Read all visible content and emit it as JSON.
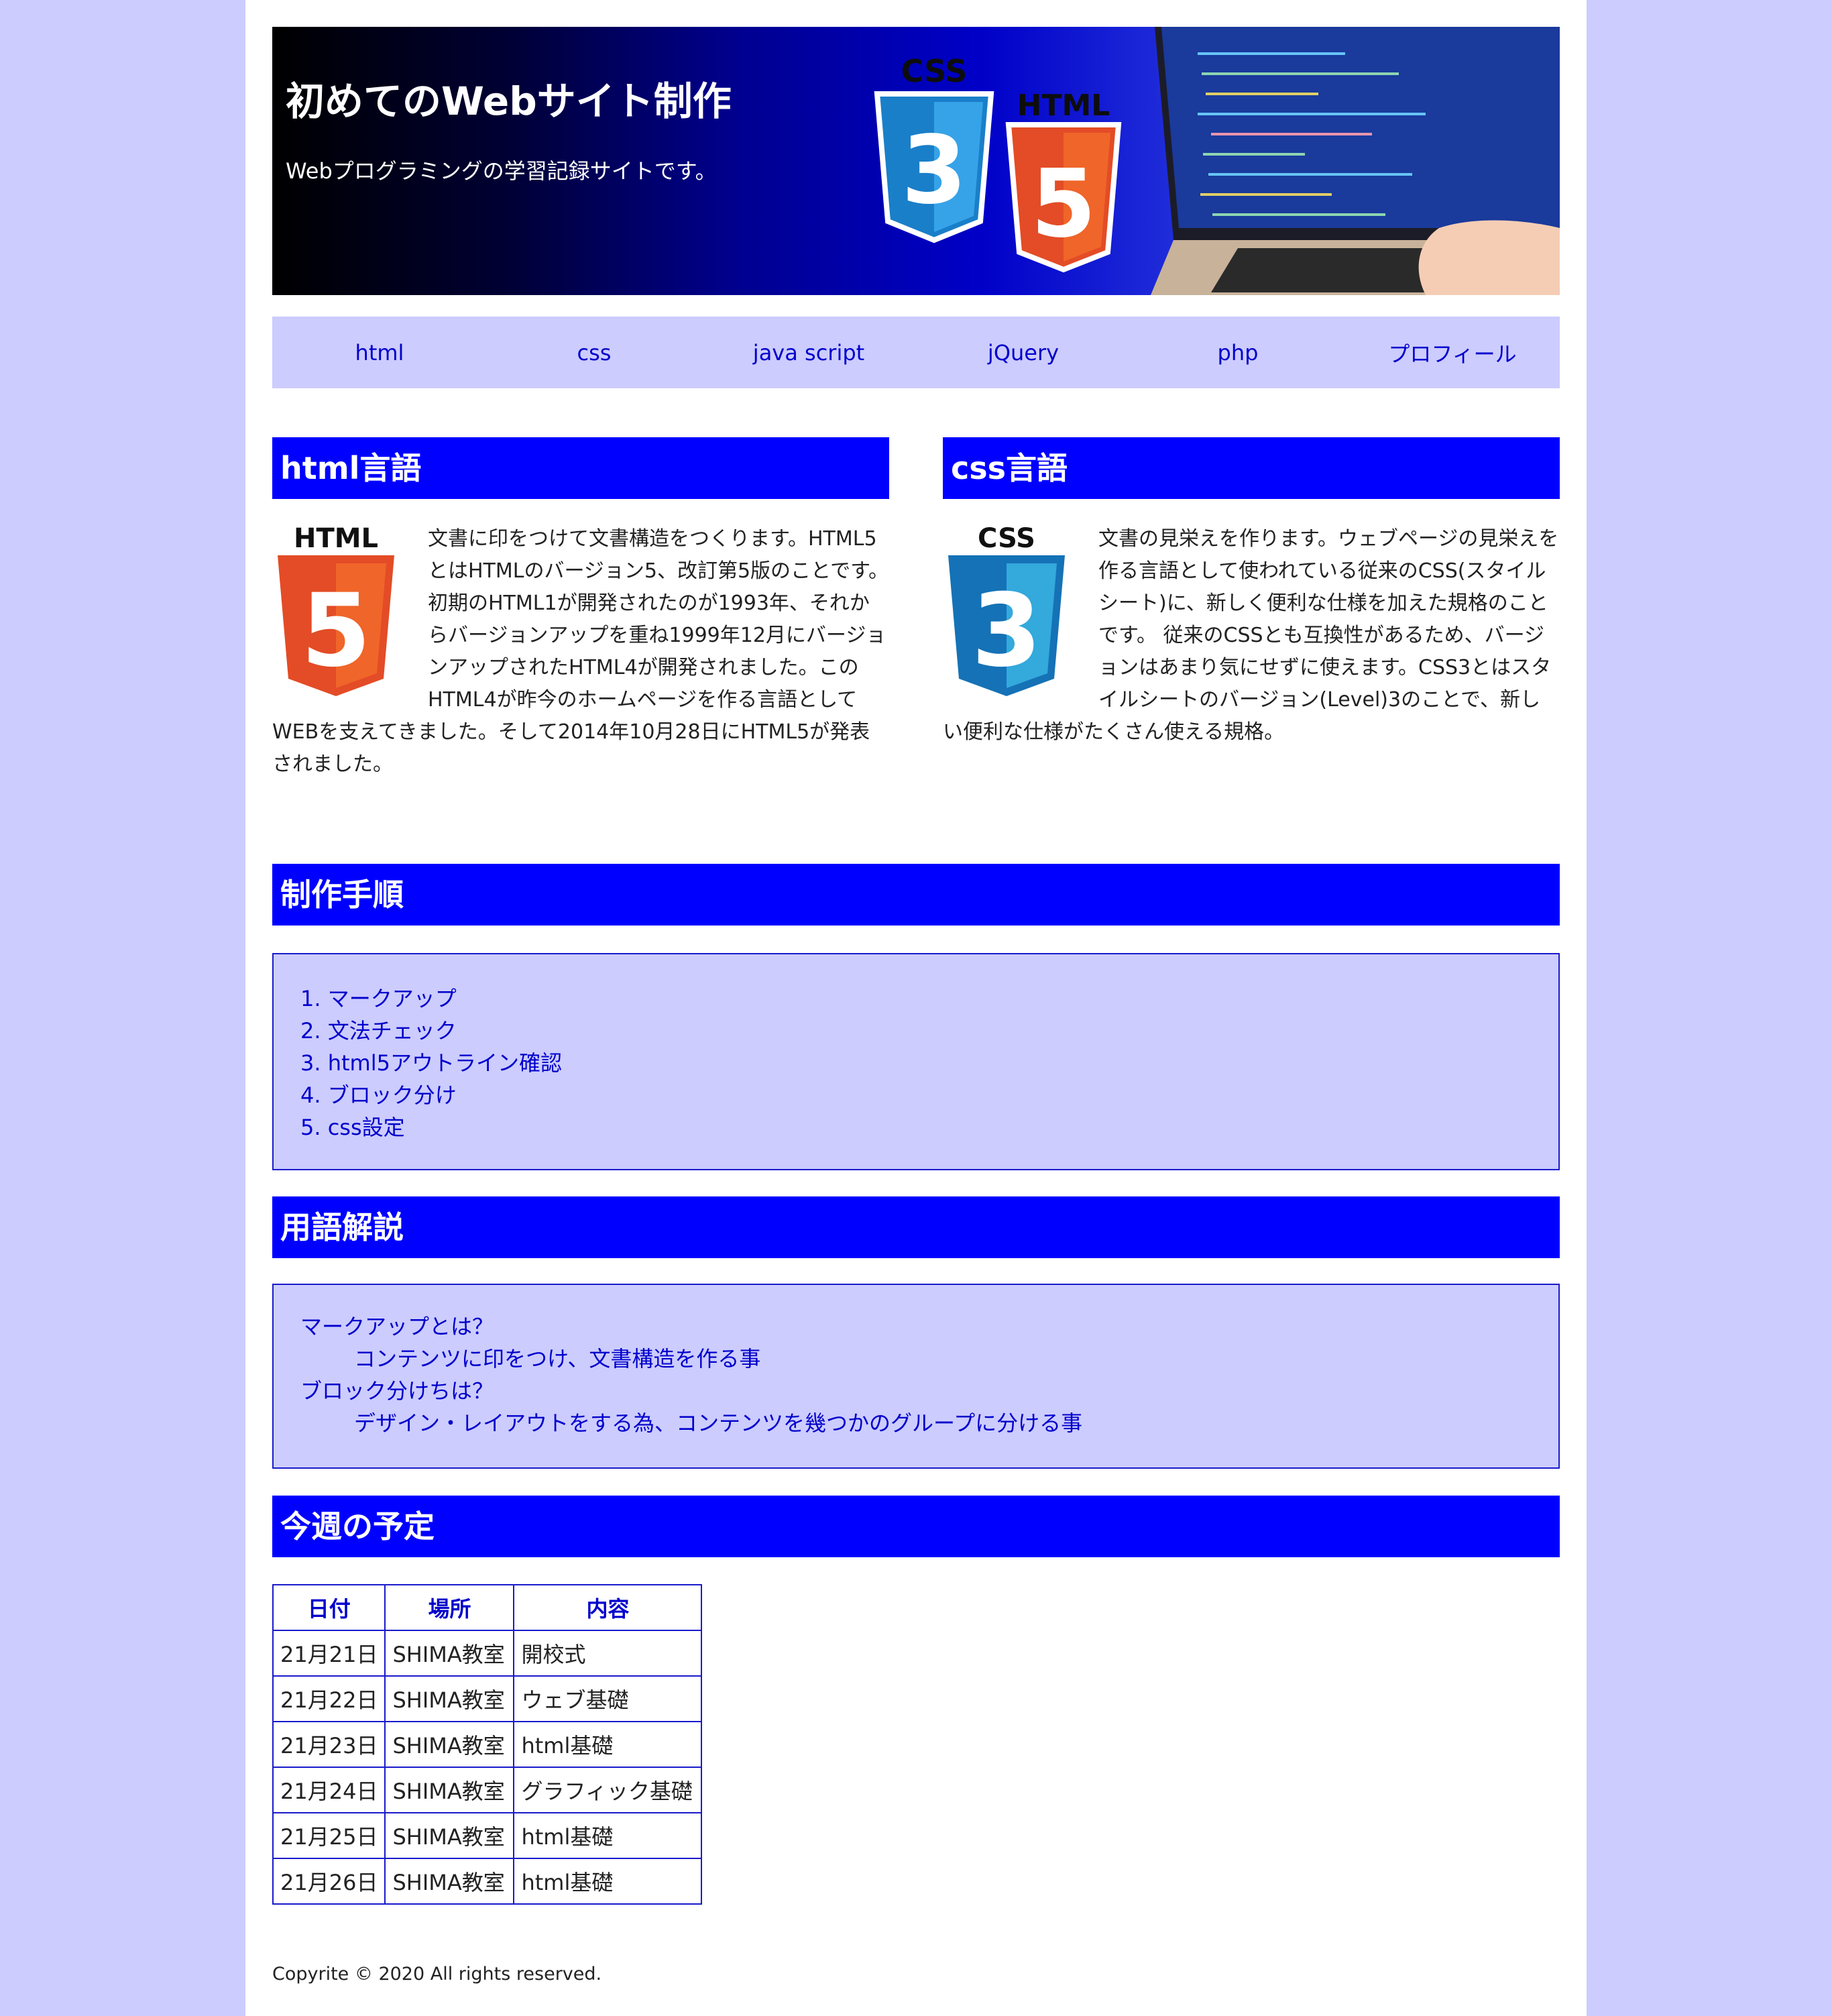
{
  "colors": {
    "page_bg": "#ccccff",
    "heading_bg": "#0000ff",
    "link": "#0000cc",
    "border": "#1a1acc"
  },
  "header": {
    "title": "初めてのWebサイト制作",
    "subtitle": "Webプログラミングの学習記録サイトです。",
    "art": {
      "css_badge_label": "CSS",
      "css_badge_number": "3",
      "html_badge_label": "HTML",
      "html_badge_number": "5"
    }
  },
  "nav": {
    "items": [
      "html",
      "css",
      "java script",
      "jQuery",
      "php",
      "プロフィール"
    ]
  },
  "html_section": {
    "heading": "html言語",
    "logo_label": "HTML",
    "logo_number": "5",
    "text": "文書に印をつけて文書構造をつくります。HTML5とはHTMLのバージョン5、改訂第5版のことです。初期のHTML1が開発されたのが1993年、それからバージョンアップを重ね1999年12月にバージョンアップされたHTML4が開発されました。このHTML4が昨今のホームページを作る言語としてWEBを支えてきました。そして2014年10月28日にHTML5が発表されました。"
  },
  "css_section": {
    "heading": "css言語",
    "logo_label": "CSS",
    "logo_number": "3",
    "text": "文書の見栄えを作ります。ウェブページの見栄えを作る言語として使われている従来のCSS(スタイルシート)に、新しく便利な仕様を加えた規格のことです。 従来のCSSとも互換性があるため、バージョンはあまり気にせずに使えます。CSS3とはスタイルシートのバージョン(Level)3のことで、新しい便利な仕様がたくさん使える規格。"
  },
  "steps": {
    "heading": "制作手順",
    "items": [
      "1. マークアップ",
      "2. 文法チェック",
      "3. html5アウトライン確認",
      "4. ブロック分け",
      "5. css設定"
    ]
  },
  "glossary": {
    "heading": "用語解説",
    "terms": [
      {
        "term": "マークアップとは？",
        "definition": "コンテンツに印をつけ、文書構造を作る事"
      },
      {
        "term": "ブロック分けちは？",
        "definition": "デザイン・レイアウトをする為、コンテンツを幾つかのグループに分ける事"
      }
    ]
  },
  "schedule": {
    "heading": "今週の予定",
    "columns": [
      "日付",
      "場所",
      "内容"
    ],
    "rows": [
      [
        "21月21日",
        "SHIMA教室",
        "開校式"
      ],
      [
        "21月22日",
        "SHIMA教室",
        "ウェブ基礎"
      ],
      [
        "21月23日",
        "SHIMA教室",
        "html基礎"
      ],
      [
        "21月24日",
        "SHIMA教室",
        "グラフィック基礎"
      ],
      [
        "21月25日",
        "SHIMA教室",
        "html基礎"
      ],
      [
        "21月26日",
        "SHIMA教室",
        "html基礎"
      ]
    ]
  },
  "footer": {
    "copyright": "Copyrite © 2020 All rights reserved."
  }
}
